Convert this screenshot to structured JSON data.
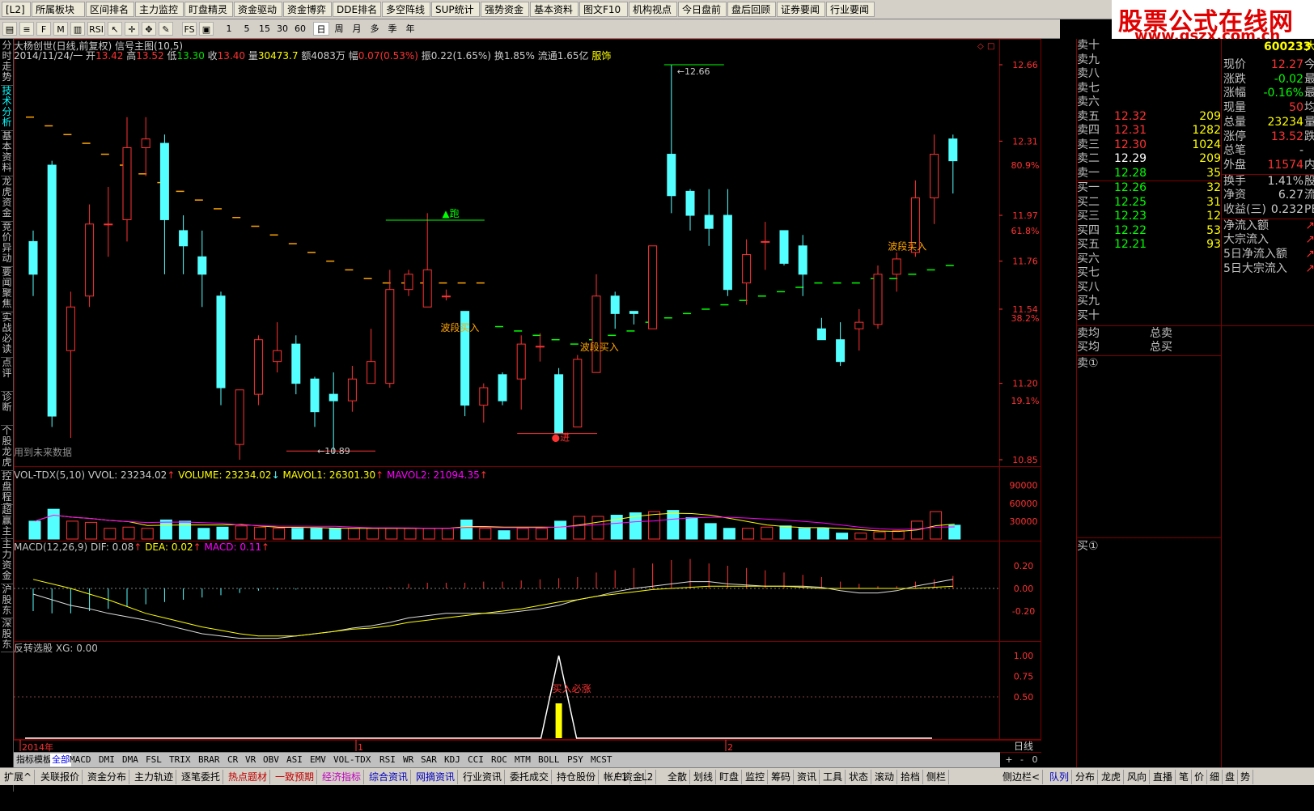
{
  "top_menu": [
    "[L2]",
    "所属板块",
    "区间排名",
    "主力监控",
    "盯盘精灵",
    "资金驱动",
    "资金博弈",
    "DDE排名",
    "多空阵线",
    "SUP统计",
    "强势资金",
    "基本资料",
    "图文F10",
    "机构视点",
    "今日盘前",
    "盘后回顾",
    "证券要闻",
    "行业要闻"
  ],
  "brand": {
    "line1": "股票公式在线网",
    "line2": "www.gszx.com.cn"
  },
  "toolbar": {
    "icons": [
      "book-icon",
      "list-icon",
      "fiz-icon",
      "m-icon",
      "chart-icon",
      "rsi-icon",
      "pointer-icon",
      "crosshair-icon",
      "pan-icon",
      "pen-icon",
      "fs-icon",
      "image-icon"
    ],
    "rsi": "RSI",
    "fs": "FS",
    "numbers": [
      "1",
      "5",
      "15",
      "30",
      "60"
    ],
    "periods": [
      "日",
      "周",
      "月",
      "多",
      "季",
      "年"
    ]
  },
  "left_tabs": [
    "分时走势",
    "技术分析",
    "基本资料",
    "龙虎资金",
    "竞价异动",
    "要闻聚焦",
    "实战必读",
    "点评",
    "诊断",
    "个股龙虎",
    "控盘程度",
    "超赢主力",
    "主力资金",
    "沪股东",
    "深股东"
  ],
  "header": {
    "title": "大杨创世(日线,前复权) 信号主图(10,5)",
    "date": "2014/11/24/一",
    "open_lbl": "开",
    "open": "13.42",
    "high_lbl": "高",
    "high": "13.52",
    "low_lbl": "低",
    "low": "13.30",
    "close_lbl": "收",
    "close": "13.40",
    "vol_lbl": "量",
    "vol": "30473.7",
    "amt_lbl": "额",
    "amt": "4083万",
    "range_lbl": "幅",
    "range": "0.07(0.53%)",
    "amp": "振0.22(1.65%)",
    "turn": "换1.85%",
    "float": "流通1.65亿",
    "industry": "服饰"
  },
  "main_axis": {
    "labels": [
      "12.66",
      "12.31",
      "11.97",
      "11.76",
      "11.54",
      "11.20",
      "10.85"
    ],
    "pcts": [
      "80.9%",
      "61.8%",
      "38.2%",
      "19.1%"
    ]
  },
  "annotations": {
    "high": "12.66",
    "low": "10.89",
    "run": "▲跑",
    "enter": "●进",
    "wave_buy": "波段买入",
    "future": "用到未来数据"
  },
  "volume": {
    "title": "VOL-TDX(5,10)",
    "vvol": "VVOL: 23234.02",
    "volume": "VOLUME: 23234.02",
    "mavol1": "MAVOL1: 26301.30",
    "mavol2": "MAVOL2: 21094.35",
    "axis": [
      "90000",
      "60000",
      "30000"
    ]
  },
  "macd": {
    "title": "MACD(12,26,9)",
    "dif": "DIF: 0.08",
    "dea": "DEA: 0.02",
    "macd": "MACD: 0.11",
    "axis": [
      "0.20",
      "0.00",
      "-0.20"
    ]
  },
  "signal": {
    "title": "反转选股",
    "xg": "XG: 0.00",
    "tag": "买入必涨",
    "axis": [
      "1.00",
      "0.75",
      "0.50"
    ]
  },
  "xaxis": {
    "labels": [
      "2014年",
      "1",
      "2"
    ],
    "period": "日线",
    "zoom": [
      "+",
      "-",
      "0"
    ]
  },
  "bottom_tabs": [
    "指标",
    "模板",
    "全部",
    "MACD",
    "DMI",
    "DMA",
    "FSL",
    "TRIX",
    "BRAR",
    "CR",
    "VR",
    "OBV",
    "ASI",
    "EMV",
    "VOL-TDX",
    "RSI",
    "WR",
    "SAR",
    "KDJ",
    "CCI",
    "ROC",
    "MTM",
    "BOLL",
    "PSY",
    "MCST"
  ],
  "status": [
    "扩展^",
    "关联报价",
    "资金分布",
    "主力轨迹",
    "逐笔委托",
    "热点题材",
    "一致预期",
    "经济指标",
    "综合资讯",
    "网摘资讯",
    "行业资讯",
    "委托成交",
    "持仓股份",
    "帐户资金",
    "L1",
    "L2",
    "全散",
    "划线",
    "盯盘",
    "监控",
    "筹码",
    "资讯",
    "工具",
    "状态",
    "滚动",
    "拾档",
    "侧栏",
    "侧边栏<",
    "队列",
    "分布",
    "龙虎",
    "风向",
    "直播",
    "笔",
    "价",
    "细",
    "盘",
    "势"
  ],
  "orderbook": {
    "sell": [
      {
        "n": "卖十",
        "p": "",
        "v": ""
      },
      {
        "n": "卖九",
        "p": "",
        "v": ""
      },
      {
        "n": "卖八",
        "p": "",
        "v": ""
      },
      {
        "n": "卖七",
        "p": "",
        "v": ""
      },
      {
        "n": "卖六",
        "p": "",
        "v": ""
      },
      {
        "n": "卖五",
        "p": "12.32",
        "v": "209"
      },
      {
        "n": "卖四",
        "p": "12.31",
        "v": "1282"
      },
      {
        "n": "卖三",
        "p": "12.30",
        "v": "1024"
      },
      {
        "n": "卖二",
        "p": "12.29",
        "v": "209"
      },
      {
        "n": "卖一",
        "p": "12.28",
        "v": "35"
      }
    ],
    "buy": [
      {
        "n": "买一",
        "p": "12.26",
        "v": "32"
      },
      {
        "n": "买二",
        "p": "12.25",
        "v": "31"
      },
      {
        "n": "买三",
        "p": "12.23",
        "v": "12"
      },
      {
        "n": "买四",
        "p": "12.22",
        "v": "53"
      },
      {
        "n": "买五",
        "p": "12.21",
        "v": "93"
      },
      {
        "n": "买六",
        "p": "",
        "v": ""
      },
      {
        "n": "买七",
        "p": "",
        "v": ""
      },
      {
        "n": "买八",
        "p": "",
        "v": ""
      },
      {
        "n": "买九",
        "p": "",
        "v": ""
      },
      {
        "n": "买十",
        "p": "",
        "v": ""
      }
    ],
    "sell_avg": "卖均",
    "buy_avg": "买均",
    "total_sell": "总卖",
    "total_buy": "总买",
    "sell1": "卖①",
    "buy1": "买①"
  },
  "quote": {
    "code": "600233",
    "code_suffix": "大",
    "rows": [
      {
        "l": "现价",
        "v": "12.27",
        "x": "今"
      },
      {
        "l": "涨跌",
        "v": "-0.02",
        "x": "最"
      },
      {
        "l": "涨幅",
        "v": "-0.16%",
        "x": "最"
      },
      {
        "l": "现量",
        "v": "50",
        "x": "均"
      },
      {
        "l": "总量",
        "v": "23234",
        "x": "量"
      },
      {
        "l": "涨停",
        "v": "13.52",
        "x": "跌"
      },
      {
        "l": "总笔",
        "v": "-",
        "x": ""
      },
      {
        "l": "外盘",
        "v": "11574",
        "x": "内"
      },
      {
        "l": "换手",
        "v": "1.41%",
        "x": "股"
      },
      {
        "l": "净资",
        "v": "6.27",
        "x": "流"
      },
      {
        "l": "收益(三)",
        "v": "0.232",
        "x": "PE"
      }
    ],
    "flow": [
      "净流入额",
      "大宗流入",
      "5日净流入额",
      "5日大宗流入"
    ]
  },
  "colors": {
    "up": "#ff3232",
    "down": "#54ffff",
    "ma5": "#ffffff",
    "ma10": "#ffff00",
    "ma20": "#ff00ff",
    "grid": "#800000",
    "signal_line": "#00ff00"
  },
  "chart_data": {
    "type": "candlestick",
    "y_range": [
      10.85,
      12.66
    ],
    "candles": [
      [
        11.85,
        11.7,
        11.9,
        11.6
      ],
      [
        12.2,
        11.05,
        12.22,
        11.0
      ],
      [
        11.35,
        11.55,
        11.62,
        10.95
      ],
      [
        11.6,
        11.93,
        12.02,
        11.55
      ],
      [
        11.93,
        11.93,
        12.1,
        11.78
      ],
      [
        11.95,
        12.28,
        12.42,
        11.85
      ],
      [
        12.28,
        12.32,
        12.42,
        12.15
      ],
      [
        12.3,
        11.95,
        12.34,
        11.7
      ],
      [
        11.9,
        11.83,
        11.97,
        11.7
      ],
      [
        11.78,
        11.7,
        11.9,
        11.55
      ],
      [
        11.6,
        11.18,
        11.62,
        11.1
      ],
      [
        10.92,
        11.17,
        11.17,
        10.85
      ],
      [
        11.15,
        11.4,
        11.42,
        11.1
      ],
      [
        11.3,
        11.35,
        11.48,
        11.25
      ],
      [
        11.38,
        11.2,
        11.42,
        11.15
      ],
      [
        11.22,
        11.07,
        11.23,
        11.0
      ],
      [
        11.15,
        11.12,
        11.25,
        10.88
      ],
      [
        11.12,
        11.22,
        11.28,
        11.07
      ],
      [
        11.2,
        11.3,
        11.45,
        11.2
      ],
      [
        11.2,
        11.63,
        11.72,
        11.18
      ],
      [
        11.63,
        11.7,
        11.72,
        11.6
      ],
      [
        11.55,
        11.72,
        11.98,
        11.55
      ],
      [
        11.6,
        11.6,
        11.63,
        11.58
      ],
      [
        11.53,
        11.1,
        11.53,
        11.05
      ],
      [
        11.1,
        11.18,
        11.2,
        11.02
      ],
      [
        11.24,
        11.12,
        11.25,
        11.1
      ],
      [
        11.22,
        11.38,
        11.42,
        11.08
      ],
      [
        11.37,
        11.37,
        11.43,
        11.3
      ],
      [
        11.24,
        10.97,
        11.27,
        10.97
      ],
      [
        11.0,
        11.31,
        11.33,
        11.0
      ],
      [
        11.25,
        11.6,
        11.7,
        11.25
      ],
      [
        11.6,
        11.52,
        11.62,
        11.45
      ],
      [
        11.53,
        11.52,
        11.53,
        11.47
      ],
      [
        11.45,
        11.83,
        11.83,
        11.45
      ],
      [
        12.25,
        12.06,
        12.66,
        11.98
      ],
      [
        12.08,
        11.97,
        12.09,
        11.9
      ],
      [
        11.97,
        11.91,
        12.09,
        11.83
      ],
      [
        11.97,
        11.63,
        12.09,
        11.6
      ],
      [
        11.66,
        11.79,
        11.86,
        11.56
      ],
      [
        11.85,
        11.85,
        11.94,
        11.72
      ],
      [
        11.9,
        11.75,
        11.9,
        11.74
      ],
      [
        11.83,
        11.7,
        11.88,
        11.6
      ],
      [
        11.45,
        11.4,
        11.5,
        11.4
      ],
      [
        11.4,
        11.3,
        11.48,
        11.28
      ],
      [
        11.45,
        11.48,
        11.54,
        11.35
      ],
      [
        11.47,
        11.7,
        11.74,
        11.45
      ],
      [
        11.7,
        11.77,
        11.8,
        11.62
      ],
      [
        11.8,
        12.05,
        12.13,
        11.78
      ],
      [
        12.05,
        12.25,
        12.34,
        11.93
      ],
      [
        12.32,
        12.22,
        12.34,
        12.07
      ]
    ],
    "ma_signal": [
      12.42,
      12.38,
      12.34,
      12.3,
      12.25,
      12.2,
      12.16,
      12.12,
      12.08,
      12.04,
      12.0,
      11.96,
      11.92,
      11.88,
      11.84,
      11.8,
      11.76,
      11.72,
      11.68,
      11.66,
      11.66,
      11.66,
      11.66,
      11.66,
      11.66,
      11.46,
      11.44,
      11.42,
      11.4,
      11.38,
      11.4,
      11.42,
      11.44,
      11.48,
      11.5,
      11.52,
      11.54,
      11.56,
      11.58,
      11.6,
      11.62,
      11.64,
      11.66,
      11.66,
      11.66,
      11.68,
      11.68,
      11.7,
      11.72,
      11.74
    ],
    "volume": [
      30000,
      50000,
      30000,
      28000,
      18000,
      20000,
      18000,
      32000,
      30000,
      18000,
      20000,
      22000,
      20000,
      18000,
      18000,
      18000,
      18000,
      18000,
      18000,
      18000,
      18000,
      18000,
      18000,
      32000,
      18000,
      14000,
      18000,
      18000,
      30000,
      38000,
      38000,
      40000,
      44000,
      46000,
      48000,
      36000,
      26000,
      18000,
      18000,
      20000,
      22000,
      18000,
      18000,
      10000,
      10000,
      12000,
      14000,
      30000,
      46000,
      23234
    ],
    "macd": [
      -0.2,
      -0.22,
      -0.22,
      -0.2,
      -0.18,
      -0.16,
      -0.14,
      -0.12,
      -0.1,
      -0.08,
      -0.06,
      -0.04,
      -0.02,
      -0.01,
      -0.01,
      0.0,
      0.0,
      0.0,
      0.0,
      0.01,
      0.04,
      0.05,
      0.05,
      0.05,
      0.06,
      0.06,
      0.07,
      0.08,
      0.09,
      0.1,
      0.14,
      0.16,
      0.18,
      0.22,
      0.25,
      0.26,
      0.22,
      0.2,
      0.18,
      0.16,
      0.14,
      0.12,
      0.1,
      0.06,
      0.04,
      0.02,
      0.02,
      0.06,
      0.08,
      0.11
    ],
    "dif": [
      -0.05,
      -0.1,
      -0.15,
      -0.18,
      -0.22,
      -0.25,
      -0.28,
      -0.32,
      -0.36,
      -0.4,
      -0.42,
      -0.44,
      -0.44,
      -0.44,
      -0.42,
      -0.4,
      -0.38,
      -0.35,
      -0.33,
      -0.3,
      -0.26,
      -0.24,
      -0.22,
      -0.22,
      -0.22,
      -0.22,
      -0.2,
      -0.18,
      -0.15,
      -0.1,
      -0.07,
      -0.03,
      0.0,
      0.02,
      0.04,
      0.06,
      0.06,
      0.04,
      0.03,
      0.02,
      0.02,
      0.02,
      0.01,
      -0.02,
      -0.04,
      -0.04,
      -0.02,
      0.02,
      0.05,
      0.08
    ],
    "dea": [
      0.08,
      0.04,
      0.0,
      -0.05,
      -0.1,
      -0.16,
      -0.22,
      -0.26,
      -0.3,
      -0.34,
      -0.37,
      -0.4,
      -0.42,
      -0.42,
      -0.42,
      -0.4,
      -0.38,
      -0.36,
      -0.35,
      -0.33,
      -0.3,
      -0.28,
      -0.26,
      -0.24,
      -0.22,
      -0.2,
      -0.18,
      -0.15,
      -0.12,
      -0.1,
      -0.07,
      -0.05,
      -0.03,
      -0.01,
      0.0,
      0.01,
      0.02,
      0.02,
      0.02,
      0.02,
      0.02,
      0.01,
      0.0,
      0.0,
      0.0,
      0.0,
      0.0,
      0.0,
      0.01,
      0.02
    ],
    "signal_peak_index": 28
  }
}
